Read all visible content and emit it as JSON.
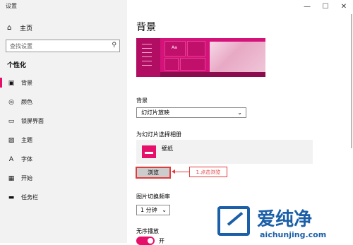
{
  "window": {
    "title": "设置",
    "minimize": "—",
    "maximize": "☐",
    "close": "✕"
  },
  "sidebar": {
    "home": "主页",
    "search_placeholder": "查找设置",
    "section": "个性化",
    "items": [
      {
        "label": "背景",
        "icon": "image-icon",
        "glyph": "▣"
      },
      {
        "label": "颜色",
        "icon": "palette-icon",
        "glyph": "◎"
      },
      {
        "label": "锁屏界面",
        "icon": "monitor-icon",
        "glyph": "▭"
      },
      {
        "label": "主题",
        "icon": "theme-icon",
        "glyph": "▨"
      },
      {
        "label": "字体",
        "icon": "font-icon",
        "glyph": "A"
      },
      {
        "label": "开始",
        "icon": "start-icon",
        "glyph": "▦"
      },
      {
        "label": "任务栏",
        "icon": "taskbar-icon",
        "glyph": "▬"
      }
    ]
  },
  "main": {
    "title": "背景",
    "preview_text": "Aa",
    "background_label": "背景",
    "background_value": "幻灯片放映",
    "album_label": "为幻灯片选择相册",
    "album_name": "壁纸",
    "browse_label": "浏览",
    "callout": "1.点击浏览",
    "interval_label": "图片切换频率",
    "interval_value": "1 分钟",
    "shuffle_label": "无序播放",
    "shuffle_state": "开"
  },
  "watermark": {
    "title": "爱纯净",
    "url": "aichunjing.com"
  },
  "colors": {
    "accent": "#e6106b",
    "annotation": "#e03c3c",
    "watermark": "#1a5fa8"
  }
}
